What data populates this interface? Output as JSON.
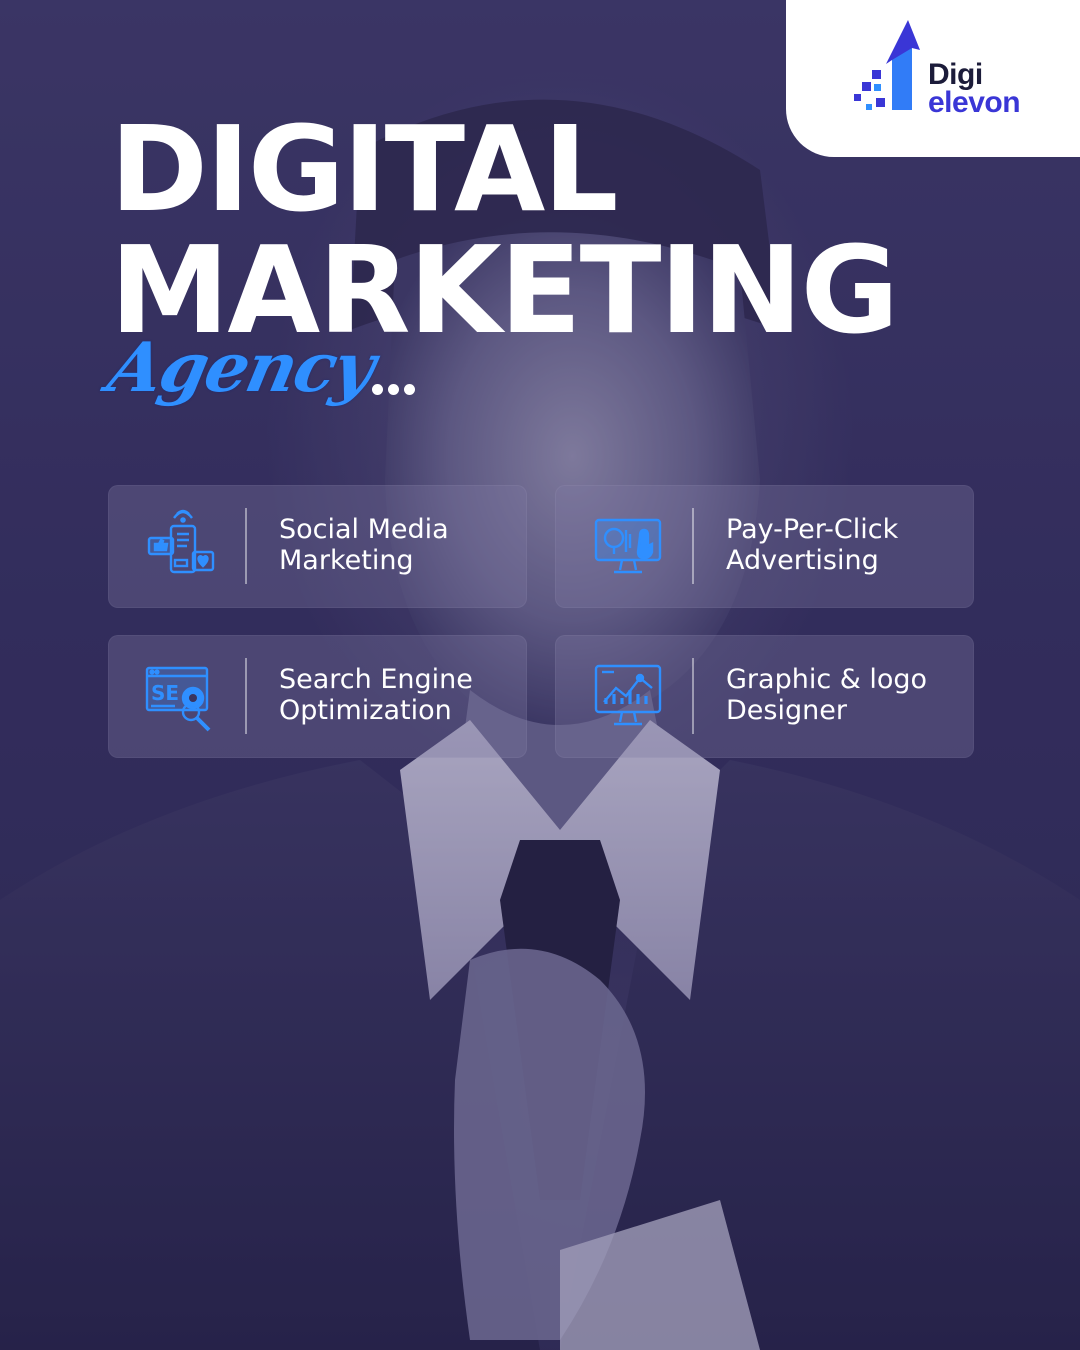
{
  "brand": {
    "line1": "Digi",
    "line2": "elevon",
    "mark_icon": "rising-arrow-pixel-icon",
    "accent_color": "#3a36d6"
  },
  "headline": {
    "line1": "DIGITAL",
    "line2": "MARKETING",
    "script": "Agency",
    "script_color": "#2f8fff"
  },
  "services": [
    {
      "line1": "Social Media",
      "line2": "Marketing",
      "icon": "social-media-phone-icon"
    },
    {
      "line1": "Pay-Per-Click",
      "line2": "Advertising",
      "icon": "ppc-monitor-click-icon"
    },
    {
      "line1": "Search Engine",
      "line2": "Optimization",
      "icon": "seo-browser-magnifier-icon"
    },
    {
      "line1": "Graphic & logo",
      "line2": "Designer",
      "icon": "graphic-design-monitor-icon"
    }
  ],
  "colors": {
    "background": "#332d5c",
    "icon_blue": "#2f8fff",
    "card_fill": "rgba(125,120,160,0.34)"
  }
}
